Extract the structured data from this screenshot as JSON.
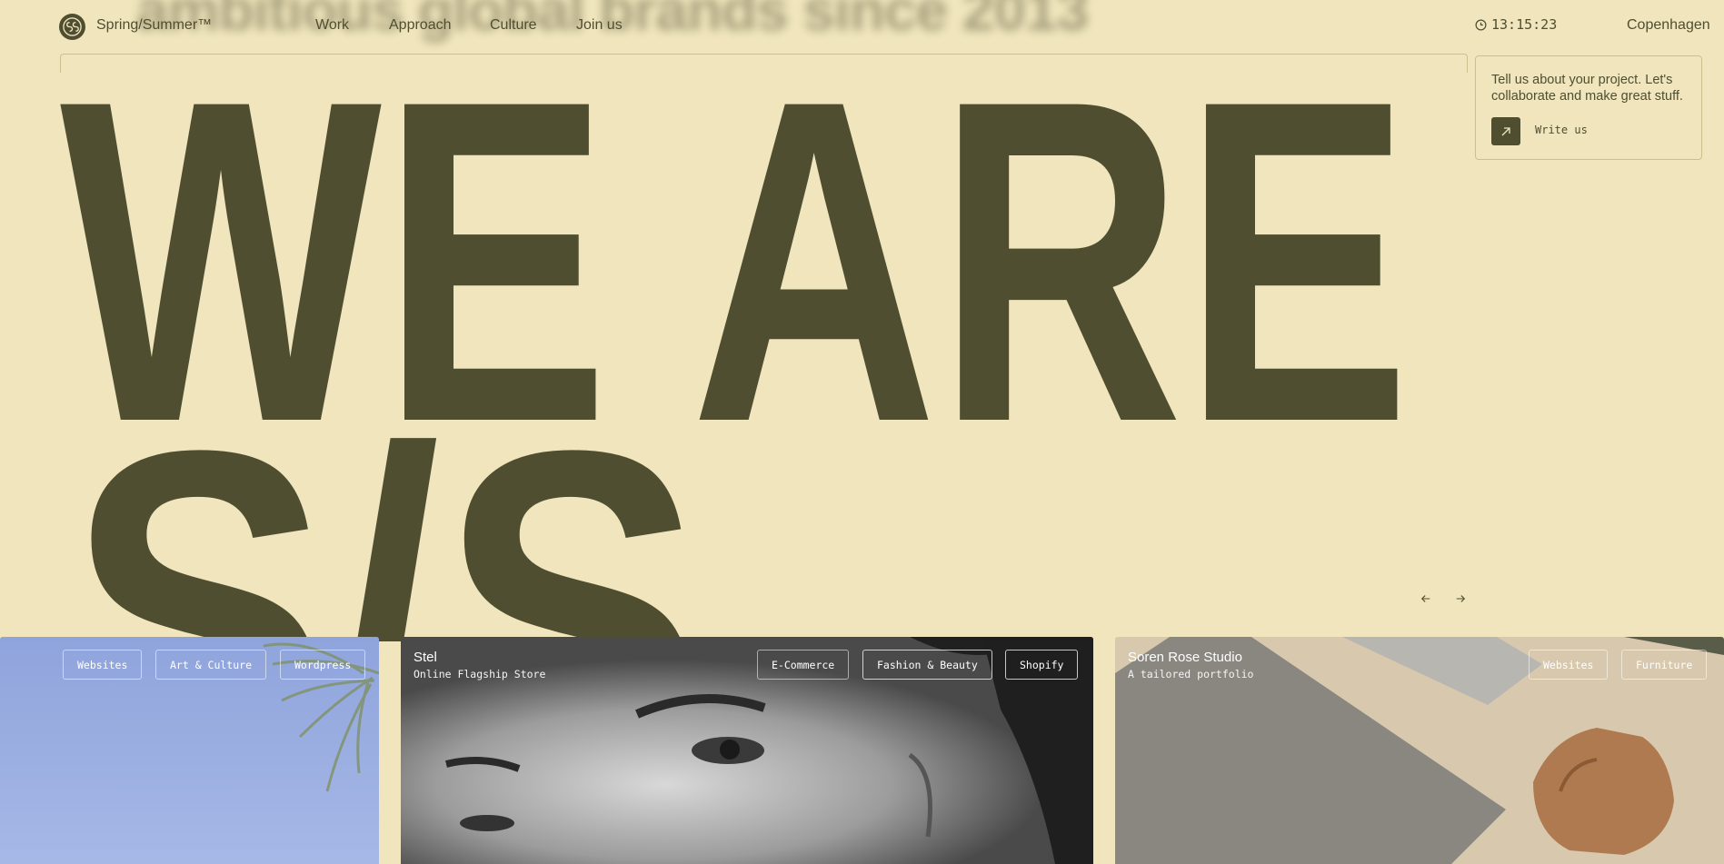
{
  "header": {
    "blurred_tagline": "ambitious global brands since 2013",
    "brand": "Spring/Summer™",
    "nav": [
      "Work",
      "Approach",
      "Culture",
      "Join us"
    ],
    "clock": "13:15:23",
    "city": "Copenhagen"
  },
  "hero": {
    "line1": "WE ARE",
    "line2": "S/S"
  },
  "contact": {
    "text": "Tell us about your project. Let's collaborate and make great stuff.",
    "button_label": "Write us"
  },
  "carousel": {
    "prev_icon": "arrow-left-icon",
    "next_icon": "arrow-right-icon",
    "cards": [
      {
        "title": "",
        "subtitle": "",
        "tags": [
          "Websites",
          "Art & Culture",
          "Wordpress"
        ]
      },
      {
        "title": "Stel",
        "subtitle": "Online Flagship Store",
        "tags": [
          "E-Commerce",
          "Fashion & Beauty",
          "Shopify"
        ]
      },
      {
        "title": "Soren Rose Studio",
        "subtitle": "A tailored portfolio",
        "tags": [
          "Websites",
          "Furniture"
        ]
      }
    ]
  },
  "colors": {
    "background": "#f0e5bc",
    "ink": "#4f4e31",
    "border": "#cdbf8d"
  }
}
